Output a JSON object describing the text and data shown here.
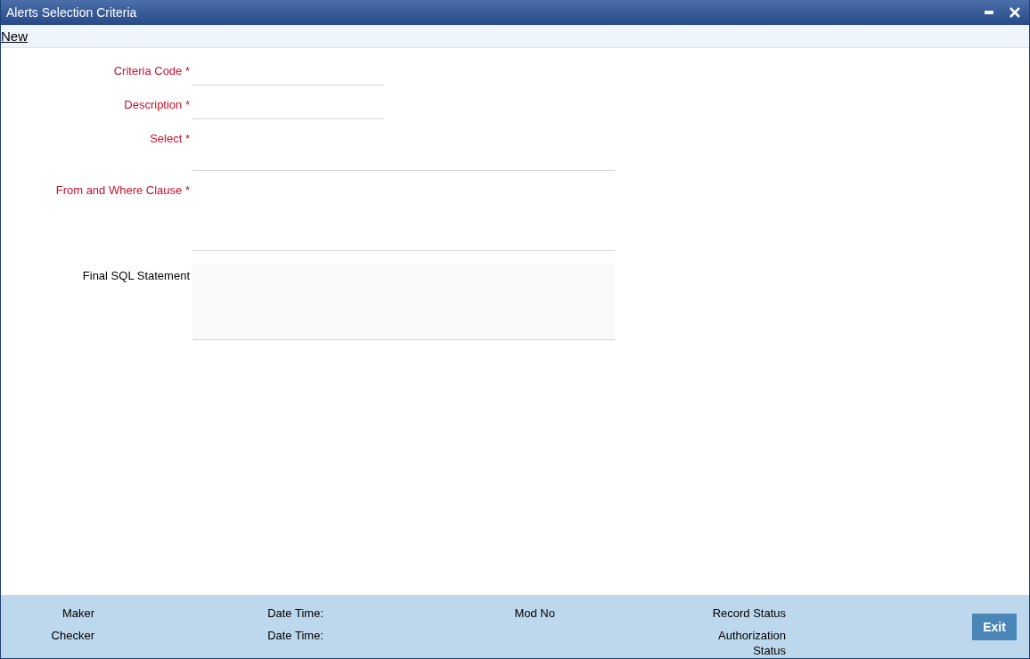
{
  "window": {
    "title": "Alerts Selection Criteria"
  },
  "toolbar": {
    "links": [
      "New"
    ]
  },
  "required_marker": "*",
  "form": {
    "fields": [
      {
        "label": "Criteria Code",
        "required": true,
        "kind": "short"
      },
      {
        "label": "Description",
        "required": true,
        "kind": "short"
      },
      {
        "label": "Select",
        "required": true,
        "kind": "medium"
      },
      {
        "label": "From and Where Clause",
        "required": true,
        "kind": "tall"
      },
      {
        "label": "Final SQL Statement",
        "required": false,
        "kind": "readonly"
      }
    ]
  },
  "footer": {
    "columns": [
      {
        "lines": [
          "Maker",
          "Checker"
        ]
      },
      {
        "lines": [
          "Date Time:",
          "Date Time:"
        ]
      },
      {
        "lines": [
          "Mod No"
        ]
      },
      {
        "lines": [
          "Record Status",
          "Authorization Status"
        ]
      }
    ],
    "button": "Exit"
  }
}
